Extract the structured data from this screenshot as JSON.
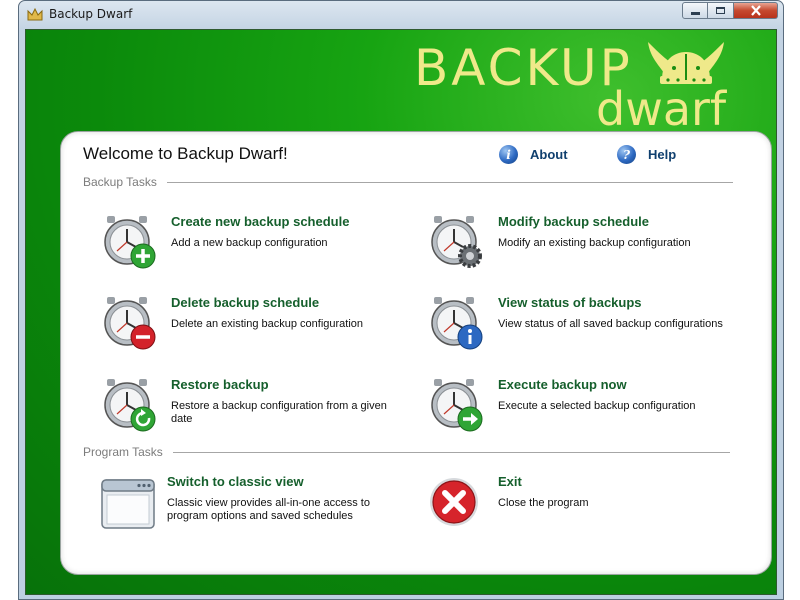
{
  "window": {
    "title": "Backup Dwarf"
  },
  "logo": {
    "line1": "BACKUP",
    "line2": "dwarf"
  },
  "header": {
    "welcome": "Welcome to Backup Dwarf!",
    "about_label": "About",
    "help_label": "Help"
  },
  "sections": {
    "backup_tasks": "Backup Tasks",
    "program_tasks": "Program Tasks"
  },
  "tasks": [
    {
      "title": "Create new backup schedule",
      "desc": "Add a new backup configuration",
      "badge": "plus-badge"
    },
    {
      "title": "Modify backup schedule",
      "desc": "Modify an existing backup configuration",
      "badge": "gear-badge"
    },
    {
      "title": "Delete backup schedule",
      "desc": "Delete an existing backup configuration",
      "badge": "minus-badge"
    },
    {
      "title": "View status of backups",
      "desc": "View status of all saved backup configurations",
      "badge": "info-badge"
    },
    {
      "title": "Restore backup",
      "desc": "Restore a backup configuration from a given date",
      "badge": "refresh-badge"
    },
    {
      "title": "Execute backup now",
      "desc": "Execute a selected backup configuration",
      "badge": "arrow-right-badge"
    }
  ],
  "program_tasks": [
    {
      "title": "Switch to classic view",
      "desc": "Classic view provides all-in-one access to program options and saved schedules",
      "icon": "window-icon"
    },
    {
      "title": "Exit",
      "desc": "Close the program",
      "icon": "exit-icon"
    }
  ],
  "colors": {
    "client_green": "#0b8a0b",
    "logo_yellow": "#efe98a",
    "task_title": "#155f2c",
    "link_blue": "#0f3f6e"
  }
}
